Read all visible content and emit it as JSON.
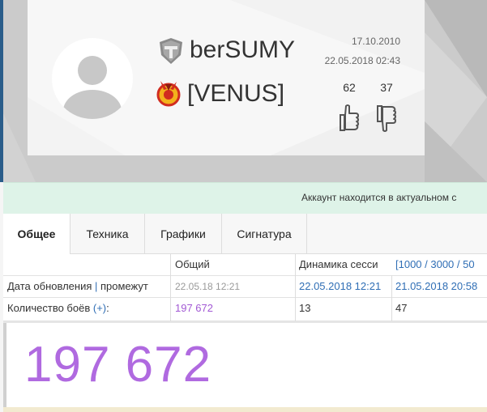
{
  "profile": {
    "nickname": "berSUMY",
    "clan_tag": "[VENUS]",
    "registration_date": "17.10.2010",
    "last_battle": "22.05.2018 02:43",
    "likes": "62",
    "dislikes": "37",
    "icons": {
      "game": "world-of-tanks-icon",
      "clan": "clan-emblem-icon",
      "avatar": "user-silhouette-icon",
      "like": "thumbs-up-icon",
      "dislike": "thumbs-down-icon"
    }
  },
  "banner": {
    "text": "Аккаунт находится в актуальном с"
  },
  "tabs": [
    {
      "label": "Общее",
      "active": true
    },
    {
      "label": "Техника",
      "active": false
    },
    {
      "label": "Графики",
      "active": false
    },
    {
      "label": "Сигнатура",
      "active": false
    }
  ],
  "table": {
    "header": {
      "total": "Общий",
      "session": "Динамика сесси",
      "ranges": "[1000 / 3000 / 50"
    },
    "rows": [
      {
        "label_main": "Дата обновления",
        "label_sep": " | ",
        "label_extra": "промежут",
        "total": "22.05.18 12:21",
        "session": "22.05.2018 12:21",
        "extra": "21.05.2018 20:58"
      },
      {
        "label_main": "Количество боёв ",
        "label_link": "(+)",
        "label_colon": ":",
        "total": "197 672",
        "session": "13",
        "extra": "47"
      }
    ]
  },
  "zoom": {
    "value": "197 672"
  },
  "colors": {
    "accent_blue": "#2f6eb5",
    "battles_purple": "#a259d4",
    "banner_green": "#def3e8"
  }
}
